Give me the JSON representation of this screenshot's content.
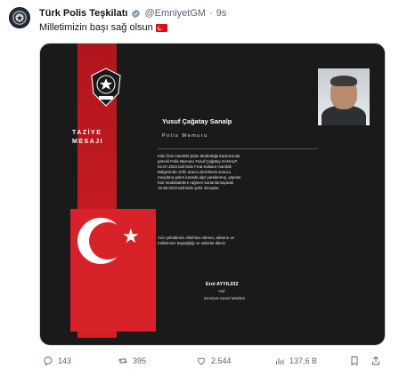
{
  "tweet": {
    "author_name": "Türk Polis Teşkilatı",
    "handle": "@EmniyetGM",
    "separator": "·",
    "time": "9s",
    "text": "Milletimizin başı sağ olsun"
  },
  "card": {
    "taziye_line1": "TAZİYE",
    "taziye_line2": "MESAJI",
    "person_name": "Yusuf Çağatay Sanalp",
    "rank": "Polis Memuru",
    "body": "Kilis Özel Harekât Şube Müdürlüğü kadrosunda\ngörevli Polis Memuru Yusuf Çağatay SANALP,\n02.07.2023 tarihinde Fırat Kalkanı Harekât\nBölgesinde zırhlı aracın devrilmesi sonucu\nmeydana gelen kazada ağır yaralanmış, yapılan\ntüm müdahalelere rağmen kurtarılamayarak\n16.08.2023 tarihinde şehit olmuştur.",
    "prayer": "Aziz şehidimize Allah'tan rahmet, ailesine ve\nmilletimize başsağlığı ve sabırlar dileriz.",
    "signatory": "Erol AYYILDIZ",
    "signatory_role": "Vali",
    "signatory_title": "Emniyet Genel Müdürü"
  },
  "actions": {
    "reply_count": "143",
    "retweet_count": "395",
    "like_count": "2.544",
    "view_count": "137,6 B"
  },
  "colors": {
    "brand_red": "#d82229",
    "verified": "#829aab",
    "muted": "#536471"
  },
  "icons": [
    "police-emblem-icon",
    "verified-badge-icon",
    "turkish-flag-icon",
    "reply-icon",
    "retweet-icon",
    "like-icon",
    "views-icon",
    "bookmark-icon",
    "share-icon"
  ]
}
